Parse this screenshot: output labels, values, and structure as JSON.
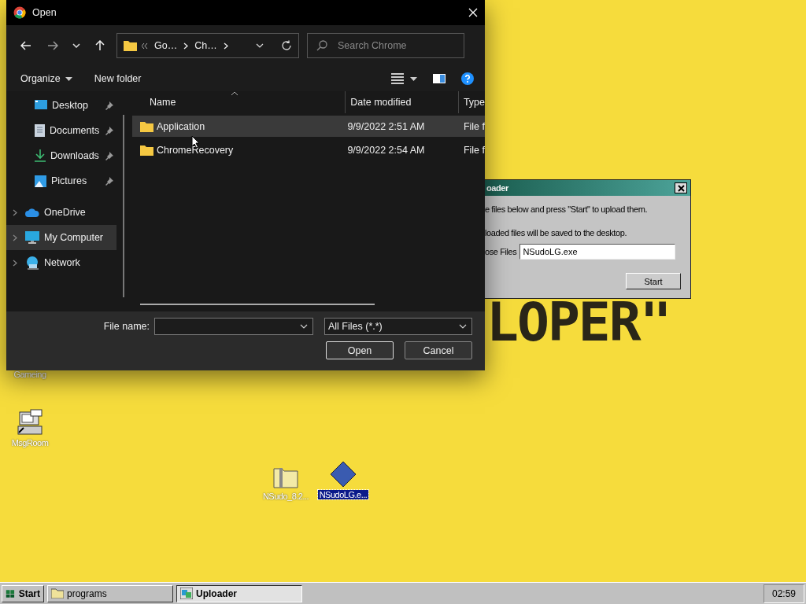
{
  "dialog": {
    "title": "Open",
    "path": [
      "Go…",
      "Ch…"
    ],
    "search": {
      "placeholder": "Search Chrome"
    },
    "toolbar": [
      "Organize",
      "New folder"
    ],
    "sidebar": [
      {
        "label": "Desktop",
        "kind": "desktop",
        "pinned": true,
        "selected": false,
        "expandable": false
      },
      {
        "label": "Documents",
        "kind": "documents",
        "pinned": true,
        "selected": false,
        "expandable": false
      },
      {
        "label": "Downloads",
        "kind": "downloads",
        "pinned": true,
        "selected": false,
        "expandable": false
      },
      {
        "label": "Pictures",
        "kind": "pictures",
        "pinned": true,
        "selected": false,
        "expandable": false
      },
      {
        "label": "OneDrive",
        "kind": "cloud",
        "pinned": false,
        "selected": false,
        "expandable": true
      },
      {
        "label": "My Computer",
        "kind": "computer",
        "pinned": false,
        "selected": true,
        "expandable": true
      },
      {
        "label": "Network",
        "kind": "network",
        "pinned": false,
        "selected": false,
        "expandable": true
      }
    ],
    "columns": [
      "Name",
      "Date modified",
      "Type"
    ],
    "rows": [
      {
        "name": "Application",
        "date": "9/9/2022 2:51 AM",
        "type": "File f",
        "selected": true
      },
      {
        "name": "ChromeRecovery",
        "date": "9/9/2022 2:54 AM",
        "type": "File f",
        "selected": false
      }
    ],
    "file_name_label": "File name:",
    "filter": "All Files (*.*)",
    "buttons": [
      "Open",
      "Cancel"
    ]
  },
  "uploader": {
    "title": "oader",
    "lines": [
      "e files below and press \"Start\" to upload them.",
      "loaded files will be saved to the desktop."
    ],
    "field_label": "ose Files",
    "field_value": "NSudoLG.exe",
    "button": "Start"
  },
  "wallpaper_text": "LOPER\"",
  "desktop_icons": [
    {
      "label": "Gameing",
      "kind": "partial",
      "selected": false
    },
    {
      "label": "MsgRoom",
      "kind": "chat",
      "selected": false
    },
    {
      "label": "NSudo_8.2...",
      "kind": "zip",
      "selected": false
    },
    {
      "label": "NSudoLG.e...",
      "kind": "diamond",
      "selected": true
    }
  ],
  "taskbar": {
    "start": "Start",
    "tasks": [
      {
        "label": "programs",
        "kind": "folder",
        "selected": false
      },
      {
        "label": "Uploader",
        "kind": "app",
        "selected": true
      }
    ],
    "clock": "02:59"
  }
}
